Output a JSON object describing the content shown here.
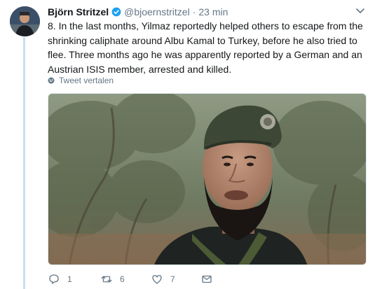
{
  "tweet": {
    "display_name": "Björn Stritzel",
    "handle": "@bjoernstritzel",
    "separator": "·",
    "time": "23 min",
    "verified": true,
    "text": "8. In the last months, Yilmaz reportedly helped others to escape from the shrinking caliphate around Albu Kamal to Turkey, before he also tried to flee. Three months ago he was apparently reported by a German and an Austrian ISIS member, arrested and killed.",
    "translate_label": "Tweet vertalen",
    "media": {
      "kind": "photo",
      "subject": "bearded man in a green beret in front of olive trees"
    }
  },
  "actions": {
    "reply_count": "1",
    "retweet_count": "6",
    "like_count": "7"
  },
  "colors": {
    "accent": "#1da1f2",
    "thread_line": "#c4dff6",
    "secondary_text": "#657786"
  },
  "icons": [
    "avatar",
    "verified-badge-icon",
    "chevron-down-icon",
    "globe-icon",
    "reply-icon",
    "retweet-icon",
    "like-icon",
    "direct-message-icon"
  ]
}
